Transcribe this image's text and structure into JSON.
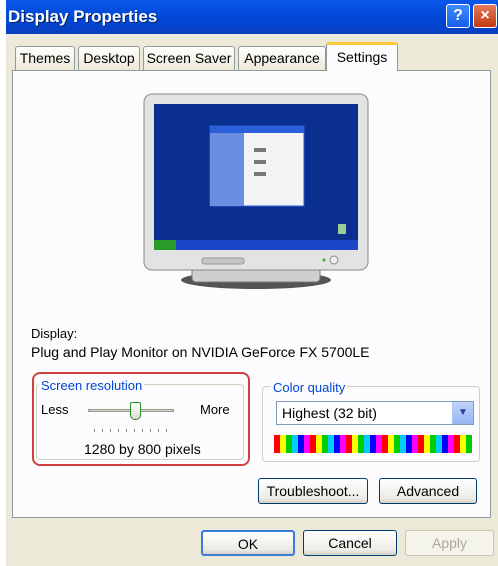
{
  "window": {
    "title": "Display Properties",
    "help_label": "?",
    "close_label": "×"
  },
  "tabs": [
    {
      "label": "Themes"
    },
    {
      "label": "Desktop"
    },
    {
      "label": "Screen Saver"
    },
    {
      "label": "Appearance"
    },
    {
      "label": "Settings",
      "active": true
    }
  ],
  "display": {
    "caption": "Display:",
    "device": "Plug and Play Monitor on NVIDIA GeForce FX 5700LE"
  },
  "resolution": {
    "legend": "Screen resolution",
    "less_label": "Less",
    "more_label": "More",
    "value_label": "1280 by 800 pixels",
    "slider_level": 0.55
  },
  "color_quality": {
    "legend": "Color quality",
    "selected": "Highest (32 bit)"
  },
  "buttons": {
    "troubleshoot": "Troubleshoot...",
    "advanced": "Advanced",
    "ok": "OK",
    "cancel": "Cancel",
    "apply": "Apply"
  },
  "colors": {
    "title_blue": "#0046d5",
    "highlight_red": "#d04040",
    "desktop_blue": "#0b2f8f"
  }
}
